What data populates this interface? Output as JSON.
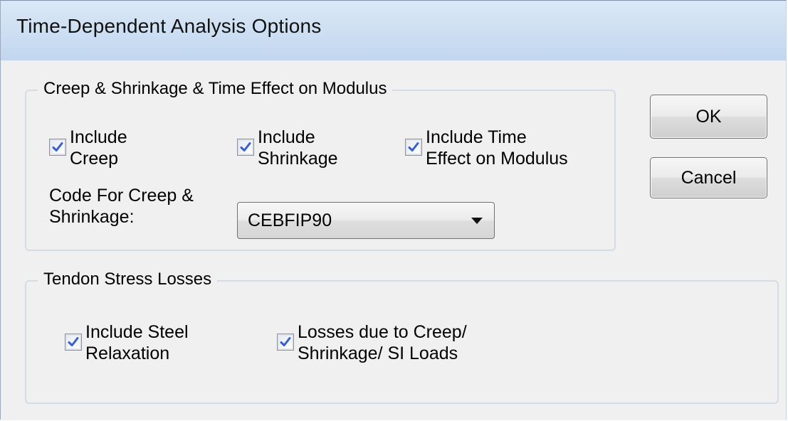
{
  "dialog": {
    "title": "Time-Dependent Analysis Options"
  },
  "creep_group": {
    "legend": "Creep & Shrinkage & Time Effect on Modulus",
    "checkboxes": [
      {
        "label": "Include\nCreep",
        "checked": true
      },
      {
        "label": "Include\nShrinkage",
        "checked": true
      },
      {
        "label": "Include Time\nEffect on Modulus",
        "checked": true
      }
    ],
    "code_label": "Code For Creep &\nShrinkage:",
    "code_value": "CEBFIP90"
  },
  "tendon_group": {
    "legend": "Tendon Stress Losses",
    "checkboxes": [
      {
        "label": "Include Steel\nRelaxation",
        "checked": true
      },
      {
        "label": "Losses due to Creep/\nShrinkage/ SI Loads",
        "checked": true
      }
    ]
  },
  "buttons": {
    "ok": "OK",
    "cancel": "Cancel"
  },
  "colors": {
    "check_mark": "#3a5fcd",
    "title_bar": "#cfe0f3",
    "client_bg": "#f0f0f0"
  }
}
